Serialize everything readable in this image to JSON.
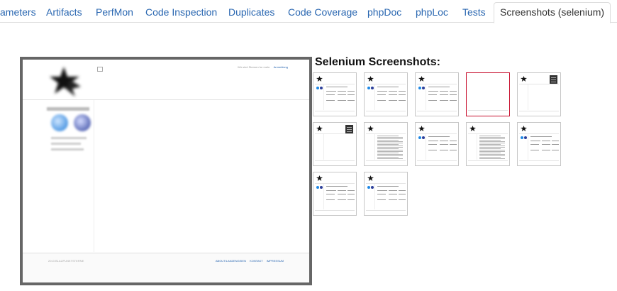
{
  "tabs": [
    {
      "label": "ameters"
    },
    {
      "label": "Artifacts"
    },
    {
      "label": "PerfMon"
    },
    {
      "label": "Code Inspection"
    },
    {
      "label": "Duplicates"
    },
    {
      "label": "Code Coverage"
    },
    {
      "label": "phpDoc"
    },
    {
      "label": "phpLoc"
    },
    {
      "label": "Tests"
    },
    {
      "label": "Screenshots (selenium)",
      "active": true
    }
  ],
  "preview": {
    "header_text": "Wir sind Sternen fur mehr",
    "login_link": "Anmeldung",
    "copyright": "2013 BLAUPUNKTSTERNE",
    "footer_links": [
      "ABOUT/LANZENGEIEN",
      "KONTAKT",
      "IMPRESSUM"
    ]
  },
  "gallery": {
    "title": "Selenium Screenshots:",
    "thumbnails": [
      {
        "variant": "normal"
      },
      {
        "variant": "normal"
      },
      {
        "variant": "normal"
      },
      {
        "variant": "blank",
        "selected": true
      },
      {
        "variant": "dark"
      },
      {
        "variant": "dark"
      },
      {
        "variant": "text"
      },
      {
        "variant": "normal"
      },
      {
        "variant": "text"
      },
      {
        "variant": "normal"
      },
      {
        "variant": "normal"
      },
      {
        "variant": "normal"
      }
    ]
  },
  "colors": {
    "link": "#2a67b1",
    "selected_border": "#c8102e",
    "preview_border": "#666666"
  }
}
